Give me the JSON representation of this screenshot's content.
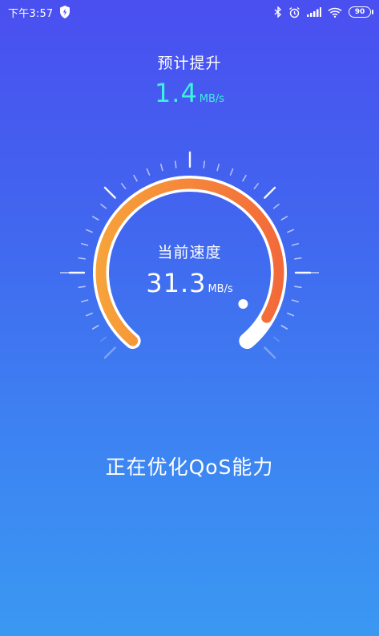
{
  "status_bar": {
    "time": "下午3:57",
    "battery": "90",
    "icons": [
      "shield-icon",
      "bluetooth-icon",
      "alarm-icon",
      "signal-icon",
      "wifi-icon",
      "battery-icon"
    ]
  },
  "predicted": {
    "label": "预计提升",
    "value": "1.4",
    "unit": "MB/s",
    "color": "#3ef0df"
  },
  "current": {
    "label": "当前速度",
    "value": "31.3",
    "unit": "MB/s",
    "gauge_level": 0.93,
    "gauge_colors": [
      "#f7a23a",
      "#f36a3a"
    ]
  },
  "status_message": "正在优化QoS能力",
  "background_colors": [
    "#4a4ff0",
    "#3a98f2"
  ]
}
